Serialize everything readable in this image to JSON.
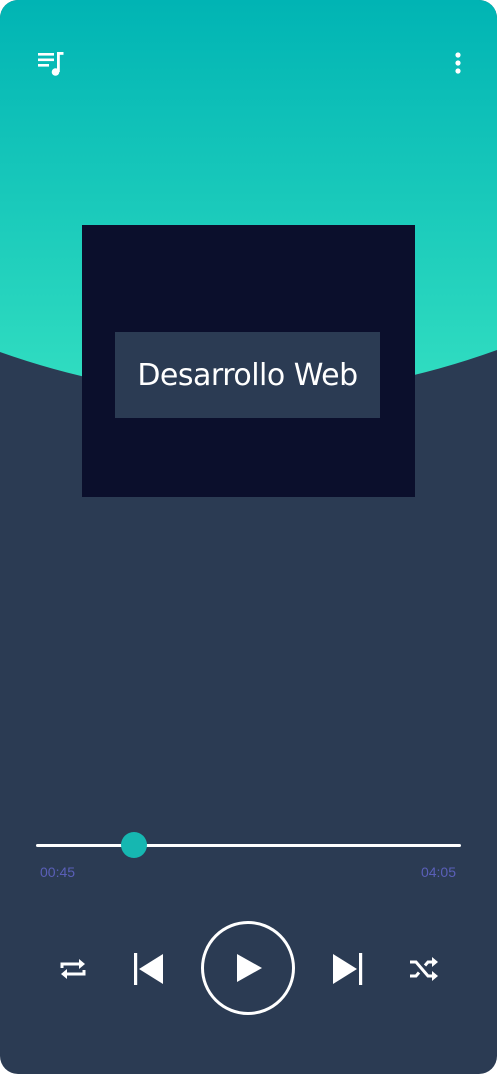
{
  "cover": {
    "title": "Desarrollo Web"
  },
  "player": {
    "current_time": "00:45",
    "total_time": "04:05",
    "progress_fraction": 0.23
  },
  "icons": {
    "playlist": "playlist-music-icon",
    "more": "more-vertical-icon",
    "repeat": "repeat-icon",
    "previous": "skip-previous-icon",
    "play": "play-icon",
    "next": "skip-next-icon",
    "shuffle": "shuffle-icon"
  },
  "colors": {
    "hero_top": "#00b5b5",
    "hero_bottom": "#2fdcc0",
    "background": "#2b3b53",
    "cover": "#0b0f2c",
    "accent": "#16b7b1",
    "time_text": "#5a5fb8"
  }
}
